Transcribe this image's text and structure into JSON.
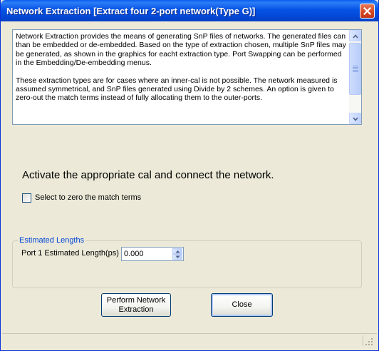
{
  "window": {
    "title": "Network Extraction [Extract four 2-port network(Type G)]"
  },
  "info": {
    "paragraph1": "Network Extraction provides the means of generating SnP files of networks.  The generated files can than be embedded or de-embedded.  Based on the type of extraction chosen, multiple SnP files may be generated, as shown in the graphics for eacht extraction type.  Port Swapping can be performed in the Embedding/De-embedding menus.",
    "paragraph2": "These extraction types are for cases where an inner-cal is not possible.  The network measured is assumed symmetrical, and  SnP files generated using Divide by 2 schemes.  An option is given to zero-out the match terms instead of fully allocating them to the outer-ports."
  },
  "instruction": "Activate the appropriate cal and connect the network.",
  "zero_match": {
    "label": "Select to zero the match terms",
    "checked": false
  },
  "lengths": {
    "group_title": "Estimated Lengths",
    "port1_label": "Port 1 Estimated Length(ps)",
    "port1_value": "0.000"
  },
  "buttons": {
    "perform": "Perform Network Extraction",
    "close": "Close"
  },
  "icons": {
    "close": "close-icon",
    "scroll_up": "chevron-up-icon",
    "scroll_down": "chevron-down-icon",
    "spin_up": "caret-up-icon",
    "spin_down": "caret-down-icon",
    "resize": "resize-grip-icon"
  },
  "colors": {
    "titlebar": "#0553e6",
    "close_button": "#d2451f",
    "group_title": "#0046d5",
    "window_bg": "#ece9d8"
  }
}
